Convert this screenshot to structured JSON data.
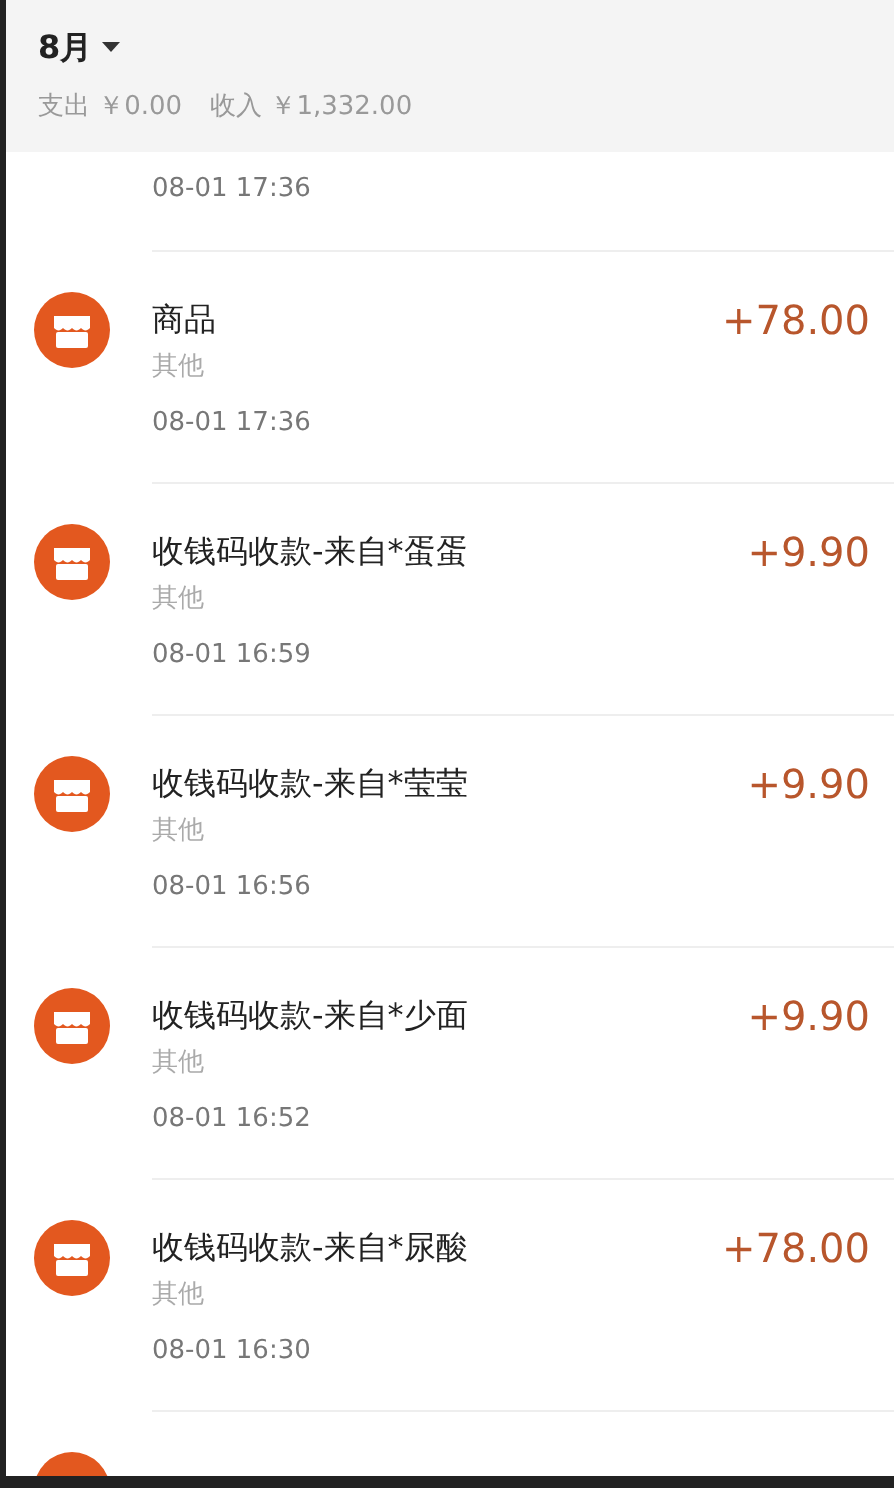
{
  "header": {
    "month": "8月",
    "expense": "支出 ￥0.00",
    "income": "收入 ￥1,332.00"
  },
  "records": [
    {
      "kind": "time_only",
      "time": "08-01 17:36"
    },
    {
      "kind": "full",
      "title": "商品",
      "category": "其他",
      "time": "08-01 17:36",
      "amount": "+78.00"
    },
    {
      "kind": "full",
      "title": "收钱码收款-来自*蛋蛋",
      "category": "其他",
      "time": "08-01 16:59",
      "amount": "+9.90"
    },
    {
      "kind": "full",
      "title": "收钱码收款-来自*莹莹",
      "category": "其他",
      "time": "08-01 16:56",
      "amount": "+9.90"
    },
    {
      "kind": "full",
      "title": "收钱码收款-来自*少面",
      "category": "其他",
      "time": "08-01 16:52",
      "amount": "+9.90"
    },
    {
      "kind": "full",
      "title": "收钱码收款-来自*尿酸",
      "category": "其他",
      "time": "08-01 16:30",
      "amount": "+78.00"
    },
    {
      "kind": "icon_only"
    }
  ]
}
